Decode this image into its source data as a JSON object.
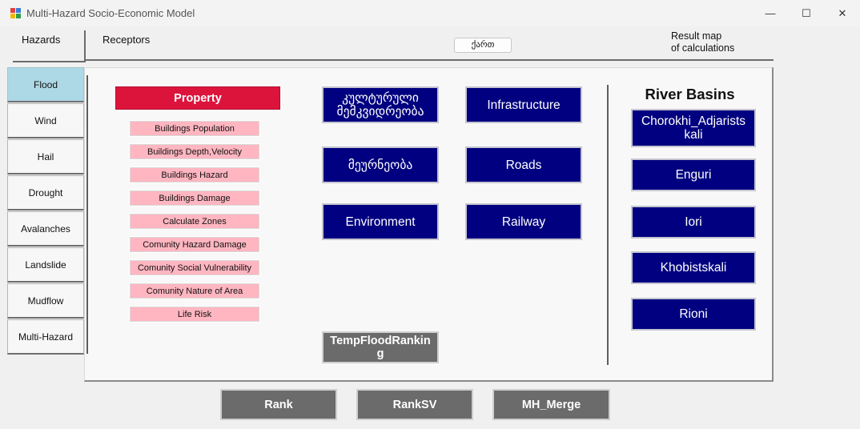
{
  "window": {
    "title": "Multi-Hazard Socio-Economic Model",
    "minimize_glyph": "—",
    "maximize_glyph": "☐",
    "close_glyph": "✕"
  },
  "header": {
    "hazards_tab": "Hazards",
    "receptors_tab": "Receptors",
    "kart_button": "ქართ",
    "result_map_line1": "Result  map",
    "result_map_line2": "of calculations"
  },
  "sidebar": {
    "items": [
      {
        "label": "Flood",
        "active": true
      },
      {
        "label": "Wind"
      },
      {
        "label": "Hail"
      },
      {
        "label": "Drought"
      },
      {
        "label": "Avalanches"
      },
      {
        "label": "Landslide"
      },
      {
        "label": "Mudflow"
      },
      {
        "label": "Multi-Hazard"
      }
    ]
  },
  "property": {
    "label": "Property",
    "items": [
      "Buildings Population",
      "Buildings Depth,Velocity",
      "Buildings Hazard",
      "Buildings Damage",
      "Calculate Zones",
      "Comunity Hazard Damage",
      "Comunity Social Vulnerability",
      "Comunity Nature of Area",
      "Life Risk"
    ]
  },
  "receptors": {
    "cultural_heritage_line1": "კულტურული",
    "cultural_heritage_line2": "მემკვიდრეობა",
    "infrastructure": "Infrastructure",
    "nature": "მეურნეობა",
    "roads": "Roads",
    "environment": "Environment",
    "railway": "Railway",
    "temp_ranking_line1": "TempFloodRankin",
    "temp_ranking_line2": "g"
  },
  "river_basins": {
    "title": "River Basins",
    "chorokhi_line1": "Chorokhi_Adjarists",
    "chorokhi_line2": "kali",
    "enguri": "Enguri",
    "iori": "Iori",
    "khobistskali": "Khobistskali",
    "rioni": "Rioni"
  },
  "footer": {
    "rank": "Rank",
    "ranksv": "RankSV",
    "mh_merge": "MH_Merge"
  },
  "colors": {
    "active_tab": "#add8e6",
    "property": "#dc143c",
    "property_items": "#ffb6c1",
    "receptor_buttons": "#000080",
    "gray_buttons": "#6b6b6b"
  }
}
